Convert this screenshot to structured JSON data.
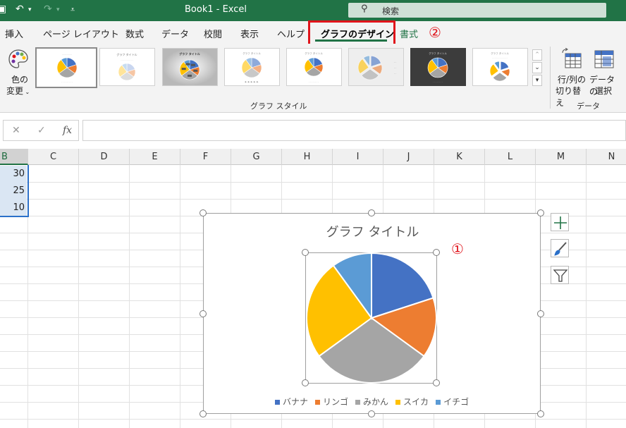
{
  "titlebar": {
    "doc_title": "Book1  -  Excel",
    "search_placeholder": "検索"
  },
  "tabs": [
    {
      "label": "挿入",
      "active": false
    },
    {
      "label": "ページ レイアウト",
      "active": false
    },
    {
      "label": "数式",
      "active": false
    },
    {
      "label": "データ",
      "active": false
    },
    {
      "label": "校閲",
      "active": false
    },
    {
      "label": "表示",
      "active": false
    },
    {
      "label": "ヘルプ",
      "active": false
    },
    {
      "label": "グラフのデザイン",
      "active": true
    },
    {
      "label": "書式",
      "active": false
    }
  ],
  "annotations": {
    "one": "①",
    "two": "②"
  },
  "ribbon": {
    "color_button": {
      "line1": "色の",
      "line2": "変更"
    },
    "style_group_label": "グラフ スタイル",
    "data_group_label": "データ",
    "switch_row_col": {
      "line1": "行/列の",
      "line2": "切り替え"
    },
    "select_data": {
      "line1": "データの",
      "line2": "選択"
    }
  },
  "formula_bar": {
    "cancel": "✕",
    "enter": "✓",
    "fx": "fx",
    "value": ""
  },
  "columns": [
    "B",
    "C",
    "D",
    "E",
    "F",
    "G",
    "H",
    "I",
    "J",
    "K",
    "L",
    "M",
    "N"
  ],
  "cells": [
    "30",
    "25",
    "10"
  ],
  "chart": {
    "title": "グラフ タイトル"
  },
  "colors": {
    "excel_green": "#217346",
    "accent_red": "#e0141b",
    "series": [
      "#4472c4",
      "#ed7d31",
      "#a5a5a5",
      "#ffc000",
      "#5b9bd5"
    ]
  },
  "chart_data": {
    "type": "pie",
    "title": "グラフ タイトル",
    "categories": [
      "バナナ",
      "リンゴ",
      "みかん",
      "スイカ",
      "イチゴ"
    ],
    "values": [
      20,
      15,
      30,
      25,
      10
    ],
    "legend_position": "bottom"
  }
}
